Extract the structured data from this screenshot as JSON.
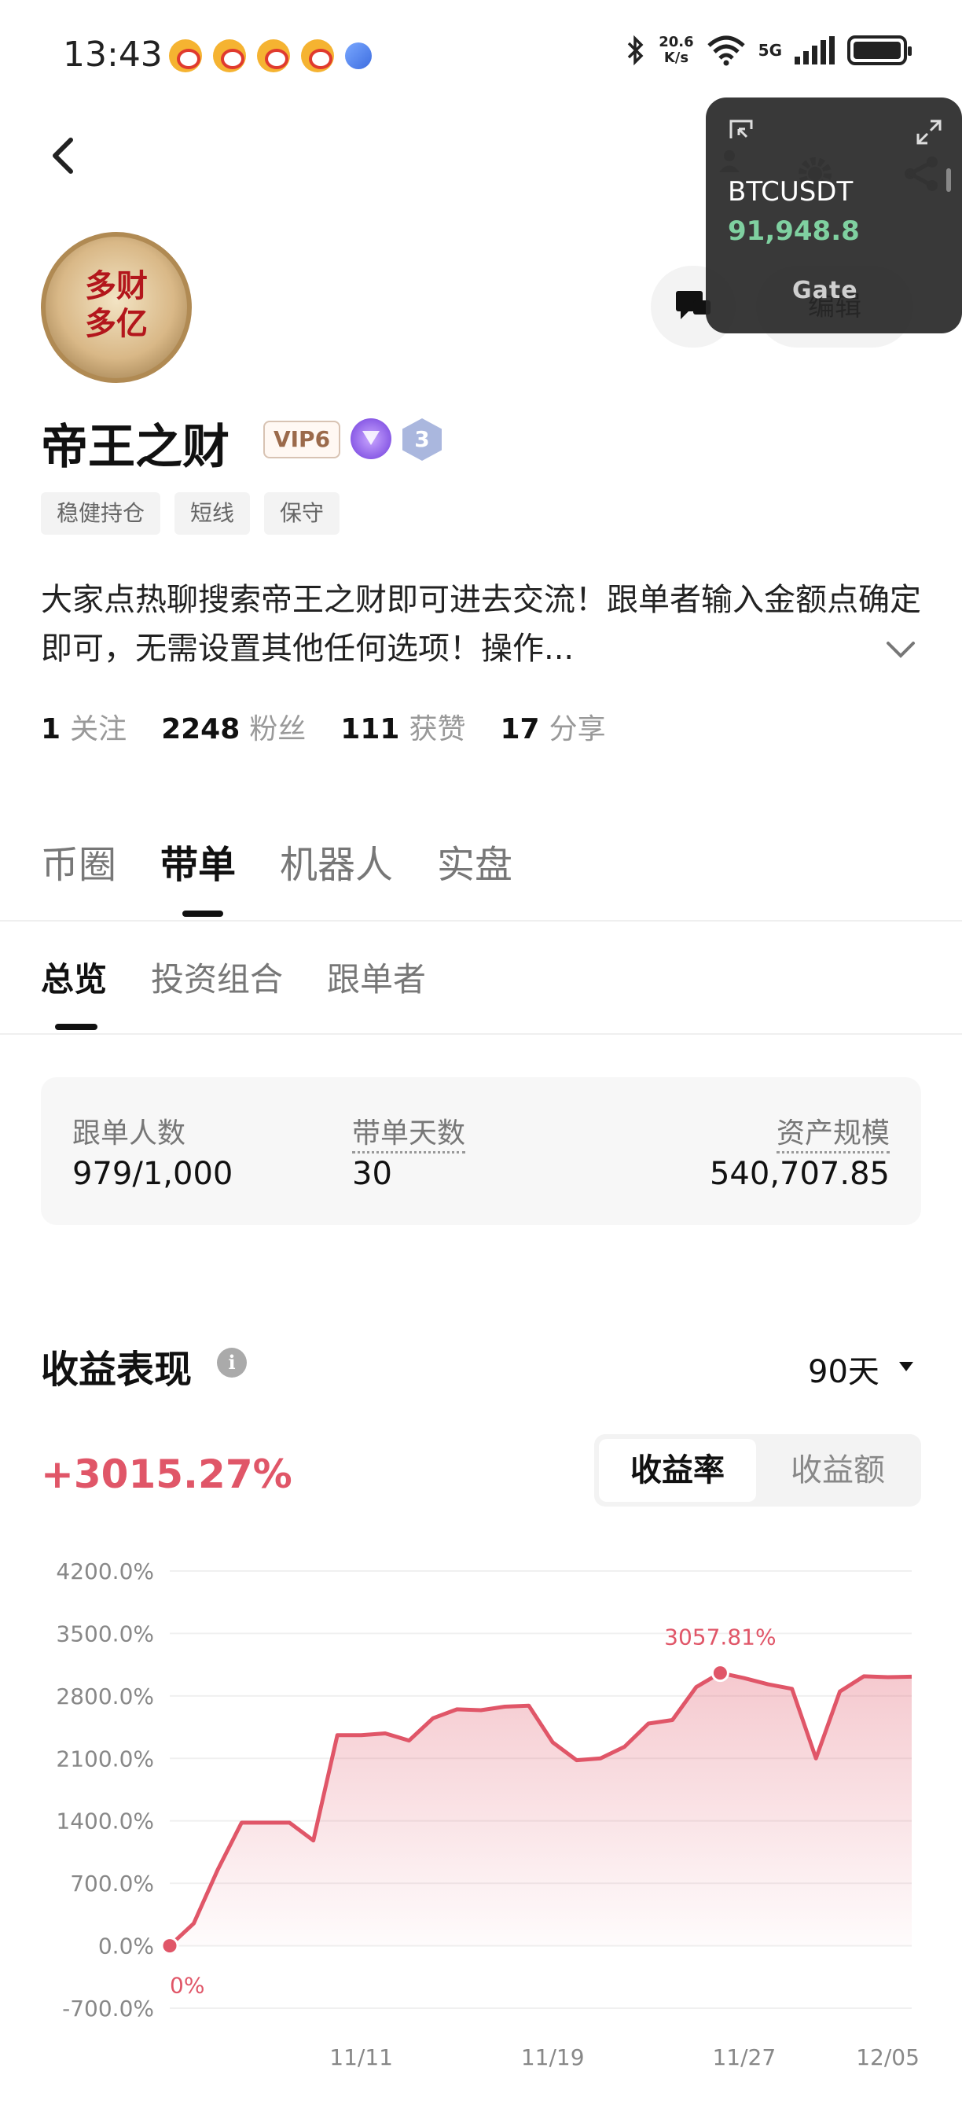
{
  "status_bar": {
    "time": "13:43",
    "net_speed_value": "20.6",
    "net_speed_unit": "K/s",
    "network_type": "5G",
    "battery_icon": "battery-full-icon"
  },
  "floating_widget": {
    "symbol": "BTCUSDT",
    "price": "91,948.8",
    "brand": "Gate",
    "price_color": "#7fd0a0"
  },
  "profile": {
    "avatar_text_line1": "多财",
    "avatar_text_line2": "多亿",
    "name": "帝王之财",
    "vip_label": "VIP6",
    "level": "3",
    "edit_label": "编辑",
    "tags": [
      "稳健持仓",
      "短线",
      "保守"
    ],
    "bio": "大家点热聊搜索帝王之财即可进去交流！跟单者输入金额点确定即可，无需设置其他任何选项！操作...",
    "stats": [
      {
        "value": "1",
        "label": "关注"
      },
      {
        "value": "2248",
        "label": "粉丝"
      },
      {
        "value": "111",
        "label": "获赞"
      },
      {
        "value": "17",
        "label": "分享"
      }
    ]
  },
  "main_tabs": [
    "币圈",
    "带单",
    "机器人",
    "实盘"
  ],
  "main_tab_active": "带单",
  "sub_tabs": [
    "总览",
    "投资组合",
    "跟单者"
  ],
  "sub_tab_active": "总览",
  "summary": {
    "followers_label": "跟单人数",
    "followers_value": "979/1,000",
    "days_label": "带单天数",
    "days_value": "30",
    "aum_label": "资产规模",
    "aum_value": "540,707.85"
  },
  "performance": {
    "title": "收益表现",
    "range": "90天",
    "pnl": "+3015.27%",
    "toggle_rate": "收益率",
    "toggle_amount": "收益额",
    "accent_color": "#e05668"
  },
  "chart_data": {
    "type": "area",
    "y_ticks": [
      "4200.0%",
      "3500.0%",
      "2800.0%",
      "2100.0%",
      "1400.0%",
      "700.0%",
      "0.0%",
      "-700.0%"
    ],
    "ylim": [
      -700,
      4200
    ],
    "x_tick_labels": [
      "11/11",
      "11/19",
      "11/27",
      "12/05"
    ],
    "x_tick_indices": [
      8,
      16,
      24,
      30
    ],
    "values": [
      0,
      250,
      850,
      1380,
      1380,
      1380,
      1180,
      2360,
      2360,
      2380,
      2300,
      2550,
      2650,
      2640,
      2680,
      2690,
      2280,
      2080,
      2100,
      2230,
      2490,
      2530,
      2900,
      3057.81,
      3000,
      2930,
      2880,
      2100,
      2850,
      3020,
      3010,
      3015.27
    ],
    "annotation_max": "3057.81%",
    "annotation_start": "0%",
    "max_index": 23,
    "line_color": "#e05668"
  }
}
